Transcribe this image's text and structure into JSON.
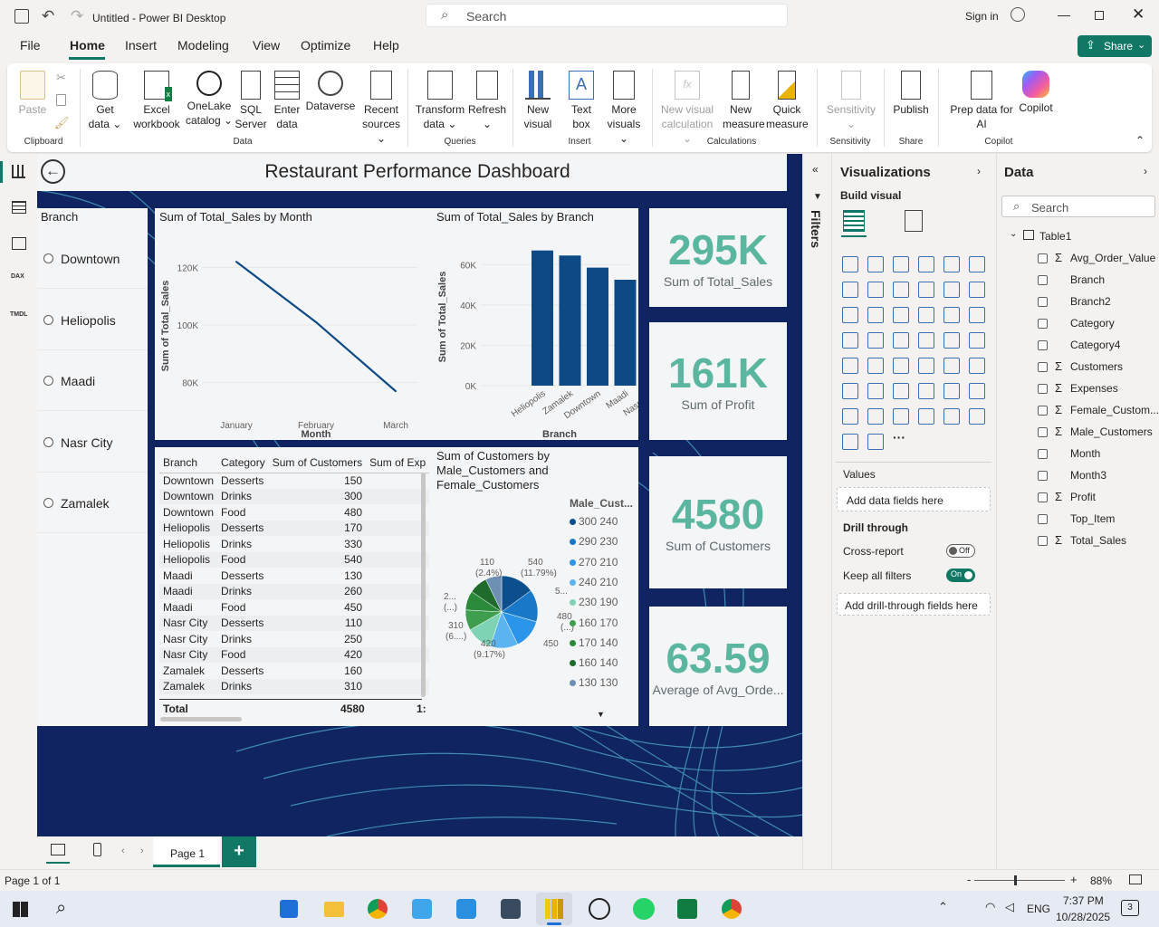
{
  "titlebar": {
    "title": "Untitled - Power BI Desktop",
    "search": "Search",
    "signin": "Sign in"
  },
  "menu": {
    "file": "File",
    "home": "Home",
    "insert": "Insert",
    "modeling": "Modeling",
    "view": "View",
    "optimize": "Optimize",
    "help": "Help",
    "share": "Share"
  },
  "ribbon": {
    "paste": "Paste",
    "get_data": "Get",
    "get_data2": "data ⌄",
    "excel": "Excel",
    "excel2": "workbook",
    "onelake": "OneLake",
    "onelake2": "catalog ⌄",
    "sql": "SQL",
    "sql2": "Server",
    "enter": "Enter",
    "enter2": "data",
    "dataverse": "Dataverse",
    "recent": "Recent",
    "recent2": "sources ⌄",
    "transform": "Transform",
    "transform2": "data ⌄",
    "refresh": "Refresh",
    "refresh2": "⌄",
    "newvisual": "New",
    "newvisual2": "visual",
    "textbox": "Text",
    "textbox2": "box",
    "more": "More",
    "more2": "visuals ⌄",
    "newcalc": "New visual",
    "newcalc2": "calculation ⌄",
    "newmeasure": "New",
    "newmeasure2": "measure",
    "quick": "Quick",
    "quick2": "measure",
    "sensitivity": "Sensitivity",
    "sensitivity2": "⌄",
    "publish": "Publish",
    "prep": "Prep data for",
    "prep2": "AI",
    "copilot": "Copilot",
    "groups": {
      "clipboard": "Clipboard",
      "data": "Data",
      "queries": "Queries",
      "insert": "Insert",
      "calculations": "Calculations",
      "sensitivity": "Sensitivity",
      "share": "Share",
      "copilot": "Copilot"
    }
  },
  "report": {
    "title": "Restaurant Performance Dashboard",
    "slicer": {
      "title": "Branch",
      "items": [
        "Downtown",
        "Heliopolis",
        "Maadi",
        "Nasr City",
        "Zamalek"
      ]
    },
    "line_title": "Sum of Total_Sales by Month",
    "bar_title": "Sum of Total_Sales by Branch",
    "pie_title": "Sum of Customers by Male_Customers and Female_Customers",
    "pie_legend_title": "Male_Cust...",
    "pie_legend": [
      "300 240",
      "290 230",
      "270 210",
      "240 210",
      "230 190",
      "160 170",
      "170 140",
      "160 140",
      "130 130"
    ],
    "pie_legend_colors": [
      "#0d4e8c",
      "#1978c8",
      "#2b95ea",
      "#5bb4ef",
      "#7ed3b4",
      "#3f9e4e",
      "#2a8a3a",
      "#1f6b2c",
      "#6c8fb3"
    ],
    "pie_labels": [
      "110",
      "(2.4%)",
      "540",
      "(11.79%)",
      "5...",
      "480",
      "(...)",
      "450",
      "420",
      "(9.17%)",
      "310",
      "(6....)",
      "2...",
      "(...)"
    ],
    "kpis": [
      {
        "value": "295K",
        "label": "Sum of Total_Sales"
      },
      {
        "value": "161K",
        "label": "Sum of Profit"
      },
      {
        "value": "4580",
        "label": "Sum of Customers"
      },
      {
        "value": "63.59",
        "label": "Average of Avg_Orde..."
      }
    ],
    "table": {
      "headers": [
        "Branch",
        "Category",
        "Sum of Customers",
        "Sum of Exp"
      ],
      "rows": [
        [
          "Downtown",
          "Desserts",
          "150"
        ],
        [
          "Downtown",
          "Drinks",
          "300"
        ],
        [
          "Downtown",
          "Food",
          "480"
        ],
        [
          "Heliopolis",
          "Desserts",
          "170"
        ],
        [
          "Heliopolis",
          "Drinks",
          "330"
        ],
        [
          "Heliopolis",
          "Food",
          "540"
        ],
        [
          "Maadi",
          "Desserts",
          "130"
        ],
        [
          "Maadi",
          "Drinks",
          "260"
        ],
        [
          "Maadi",
          "Food",
          "450"
        ],
        [
          "Nasr City",
          "Desserts",
          "110"
        ],
        [
          "Nasr City",
          "Drinks",
          "250"
        ],
        [
          "Nasr City",
          "Food",
          "420"
        ],
        [
          "Zamalek",
          "Desserts",
          "160"
        ],
        [
          "Zamalek",
          "Drinks",
          "310"
        ]
      ],
      "total_label": "Total",
      "total_value": "4580",
      "total_exp": "1:"
    }
  },
  "chart_data": [
    {
      "type": "line",
      "title": "Sum of Total_Sales by Month",
      "xlabel": "Month",
      "ylabel": "Sum of Total_Sales",
      "categories": [
        "January",
        "February",
        "March"
      ],
      "values": [
        122000,
        101000,
        77000
      ],
      "ylim": [
        72000,
        128000
      ],
      "yticks": [
        "80K",
        "100K",
        "120K"
      ],
      "ytick_values": [
        80000,
        100000,
        120000
      ]
    },
    {
      "type": "bar",
      "title": "Sum of Total_Sales by Branch",
      "xlabel": "Branch",
      "ylabel": "Sum of Total_Sales",
      "categories": [
        "Heliopolis",
        "Zamalek",
        "Downtown",
        "Maadi",
        "Nasr City"
      ],
      "values": [
        67000,
        64500,
        58500,
        52500,
        49500
      ],
      "ylim": [
        0,
        70000
      ],
      "yticks": [
        "0K",
        "20K",
        "40K",
        "60K"
      ],
      "ytick_values": [
        0,
        20000,
        40000,
        60000
      ]
    },
    {
      "type": "pie",
      "title": "Sum of Customers by Male_Customers and Female_Customers",
      "categories": [
        "300 240",
        "290 230",
        "270 210",
        "240 210",
        "230 190",
        "160 170",
        "170 140",
        "160 140",
        "130 130"
      ],
      "values": [
        540,
        520,
        480,
        450,
        420,
        330,
        310,
        300,
        260
      ]
    }
  ],
  "filters": {
    "label": "Filters"
  },
  "viz": {
    "title": "Visualizations",
    "build": "Build visual",
    "values": "Values",
    "add_fields": "Add data fields here",
    "drill": "Drill through",
    "cross": "Cross-report",
    "cross_state": "Off",
    "keep": "Keep all filters",
    "keep_state": "On",
    "add_drill": "Add drill-through fields here"
  },
  "data": {
    "title": "Data",
    "search": "Search",
    "table": "Table1",
    "fields": [
      "Avg_Order_Value",
      "Branch",
      "Branch2",
      "Category",
      "Category4",
      "Customers",
      "Expenses",
      "Female_Custom...",
      "Male_Customers",
      "Month",
      "Month3",
      "Profit",
      "Top_Item",
      "Total_Sales"
    ],
    "sigma": [
      true,
      false,
      false,
      false,
      false,
      true,
      true,
      true,
      true,
      false,
      false,
      true,
      false,
      true
    ]
  },
  "pagebar": {
    "page": "Page 1",
    "add": "+"
  },
  "status": {
    "page": "Page 1 of 1",
    "zoom": "88%",
    "minus": "-",
    "plus": "+"
  },
  "taskbar": {
    "lang": "ENG",
    "time": "7:37 PM",
    "date": "10/28/2025",
    "notif": "3"
  },
  "colors": {
    "accent": "#117865",
    "bar": "#0d4a85",
    "kpi": "#5bb6a0",
    "canvas_bg": "#0f2461"
  }
}
